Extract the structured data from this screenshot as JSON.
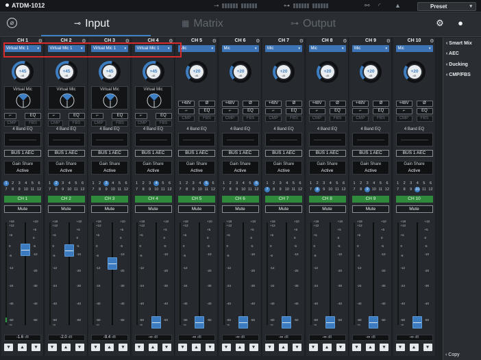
{
  "device_name": "ATDM-1012",
  "preset_label": "Preset",
  "tabs": [
    {
      "label": "Input",
      "icon": "input-arrow-icon",
      "active": true
    },
    {
      "label": "Matrix",
      "icon": "matrix-grid-icon",
      "active": false
    },
    {
      "label": "Output",
      "icon": "output-arrow-icon",
      "active": false
    }
  ],
  "right_panel": {
    "items": [
      "Smart Mix",
      "AEC",
      "Ducking",
      "CMP/FBS"
    ],
    "copy_label": "Copy"
  },
  "strip_labels": {
    "phantom": "+48V",
    "phase": "Ø",
    "eq": "EQ",
    "cmp": "CMP",
    "fbs": "FBS",
    "eq_title": "4 Band EQ",
    "gain_share": "Gain Share",
    "mute": "Mute",
    "db_unit": "dB",
    "virtual_mic_title": "Virtual Mic",
    "knob_unit": "dB",
    "group_numbers": [
      "1",
      "2",
      "3",
      "4",
      "5",
      "6",
      "7",
      "8",
      "9",
      "10",
      "11",
      "12"
    ]
  },
  "fader_scale": [
    "+18",
    "+12",
    "+6",
    "0",
    "-6",
    "-12",
    "-24",
    "-40",
    "-60",
    "-∞"
  ],
  "fader_scale_right": [
    "+10",
    "+5",
    "0",
    "-5",
    "-10",
    "-20",
    "-30",
    "-40",
    "-50"
  ],
  "channels": [
    {
      "header": "CH 1",
      "source": "Virtual Mic 1",
      "gain": "+45",
      "virtual_mic": true,
      "bus": "BUS 1 AEC",
      "gain_share": "Active",
      "group": 1,
      "name": "CH 1",
      "level_db": "-1.6",
      "fader_level_db": -1.6,
      "meter_level": 0.05
    },
    {
      "header": "CH 2",
      "source": "Virtual Mic 1",
      "gain": "+45",
      "virtual_mic": true,
      "bus": "BUS 1 AEC",
      "gain_share": "Active",
      "group": 2,
      "name": "CH 2",
      "level_db": "-2.0",
      "fader_level_db": -2.0,
      "meter_level": 0
    },
    {
      "header": "CH 3",
      "source": "Virtual Mic 1",
      "gain": "+45",
      "virtual_mic": true,
      "bus": "BUS 1 AEC",
      "gain_share": "Active",
      "group": 3,
      "name": "CH 3",
      "level_db": "-9.4",
      "fader_level_db": -9.4,
      "meter_level": 0
    },
    {
      "header": "CH 4",
      "source": "Virtual Mic 1",
      "gain": "+45",
      "virtual_mic": true,
      "bus": "BUS 1 AEC",
      "gain_share": "Active",
      "group": 4,
      "name": "CH 4",
      "level_db": "-∞",
      "fader_level_db": -999,
      "meter_level": 0
    },
    {
      "header": "CH 5",
      "source": "Mic",
      "gain": "+20",
      "virtual_mic": false,
      "bus": "BUS 1 AEC",
      "gain_share": "Active",
      "group": 5,
      "name": "CH 5",
      "level_db": "-∞",
      "fader_level_db": -999,
      "meter_level": 0
    },
    {
      "header": "CH 6",
      "source": "Mic",
      "gain": "+20",
      "virtual_mic": false,
      "bus": "BUS 1 AEC",
      "gain_share": "Active",
      "group": 6,
      "name": "CH 6",
      "level_db": "-∞",
      "fader_level_db": -999,
      "meter_level": 0
    },
    {
      "header": "CH 7",
      "source": "Mic",
      "gain": "+20",
      "virtual_mic": false,
      "bus": "BUS 1 AEC",
      "gain_share": "Active",
      "group": 7,
      "name": "CH 7",
      "level_db": "-∞",
      "fader_level_db": -999,
      "meter_level": 0
    },
    {
      "header": "CH 8",
      "source": "Mic",
      "gain": "+20",
      "virtual_mic": false,
      "bus": "BUS 1 AEC",
      "gain_share": "Active",
      "group": 8,
      "name": "CH 8",
      "level_db": "-∞",
      "fader_level_db": -999,
      "meter_level": 0
    },
    {
      "header": "CH 9",
      "source": "Mic",
      "gain": "+20",
      "virtual_mic": false,
      "bus": "BUS 1 AEC",
      "gain_share": "Active",
      "group": 9,
      "name": "CH 9",
      "level_db": "-∞",
      "fader_level_db": -999,
      "meter_level": 0
    },
    {
      "header": "CH 10",
      "source": "Mic",
      "gain": "+20",
      "virtual_mic": false,
      "bus": "BUS 1 AEC",
      "gain_share": "Active",
      "group": 10,
      "name": "CH 10",
      "level_db": "-∞",
      "fader_level_db": -999,
      "meter_level": 0
    }
  ],
  "colors": {
    "accent": "#3e7fc3",
    "channel_name": "#2f8a3c",
    "highlight": "#d92b2b"
  }
}
